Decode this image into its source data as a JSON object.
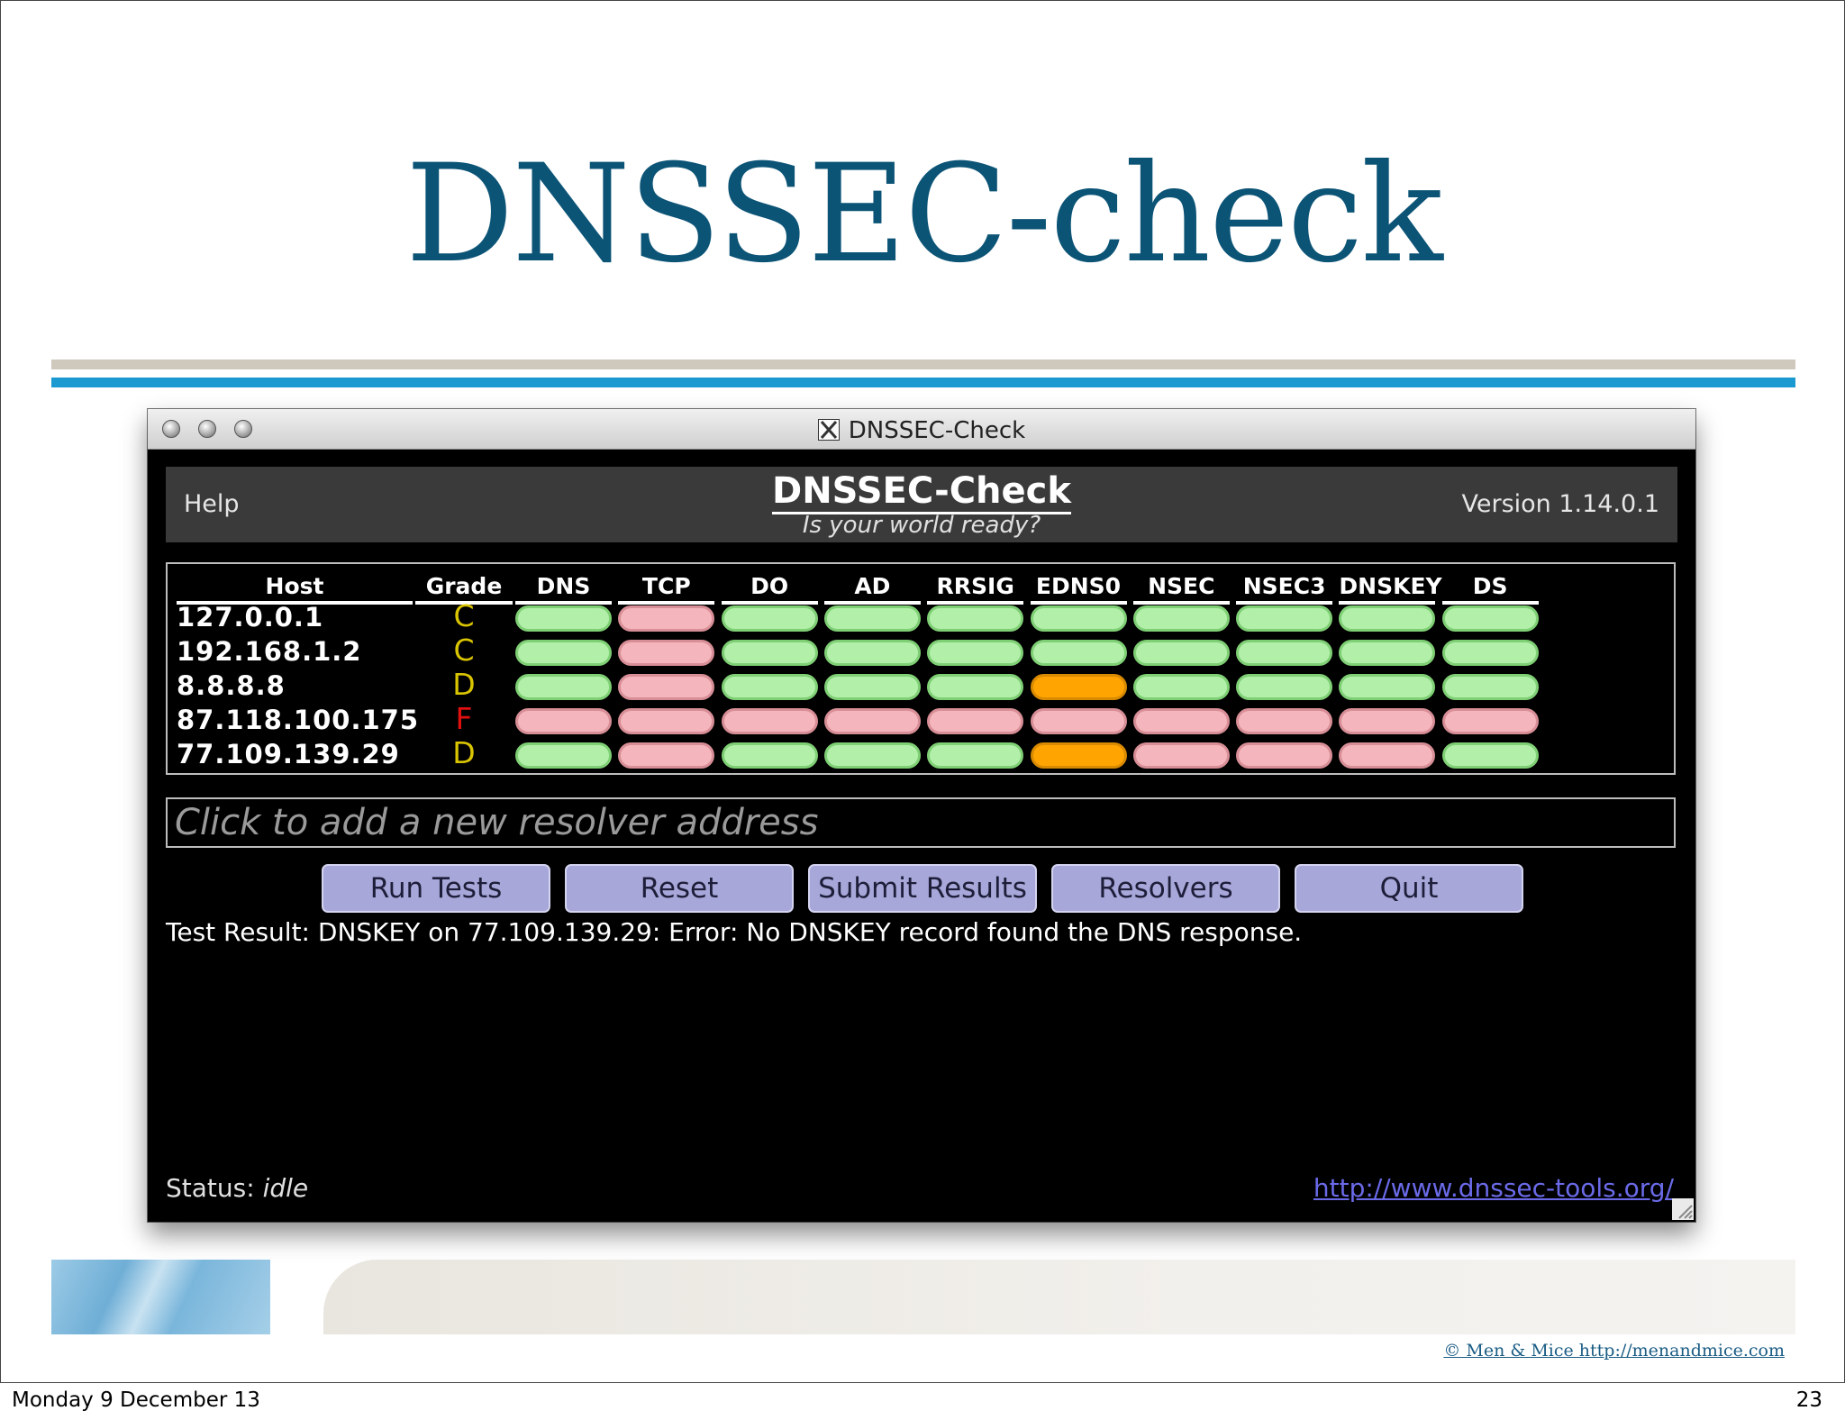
{
  "slide": {
    "title": "DNSSEC-check",
    "copyright": "© Men & Mice  http://menandmice.com"
  },
  "window": {
    "title": "DNSSEC-Check",
    "x_icon_label": "X"
  },
  "app": {
    "help_label": "Help",
    "title": "DNSSEC-Check",
    "subtitle": "Is your world ready?",
    "version": "Version 1.14.0.1"
  },
  "table": {
    "columns": [
      "Host",
      "Grade",
      "DNS",
      "TCP",
      "DO",
      "AD",
      "RRSIG",
      "EDNS0",
      "NSEC",
      "NSEC3",
      "DNSKEY",
      "DS"
    ],
    "rows": [
      {
        "host": "127.0.0.1",
        "grade": "C",
        "grade_color": "#d9c400",
        "status": [
          "pass",
          "fail",
          "pass",
          "pass",
          "pass",
          "pass",
          "pass",
          "pass",
          "pass",
          "pass"
        ]
      },
      {
        "host": "192.168.1.2",
        "grade": "C",
        "grade_color": "#d9c400",
        "status": [
          "pass",
          "fail",
          "pass",
          "pass",
          "pass",
          "pass",
          "pass",
          "pass",
          "pass",
          "pass"
        ]
      },
      {
        "host": "8.8.8.8",
        "grade": "D",
        "grade_color": "#d9c400",
        "status": [
          "pass",
          "fail",
          "pass",
          "pass",
          "pass",
          "warn",
          "pass",
          "pass",
          "pass",
          "pass"
        ]
      },
      {
        "host": "87.118.100.175",
        "grade": "F",
        "grade_color": "#e01010",
        "status": [
          "fail",
          "fail",
          "fail",
          "fail",
          "fail",
          "fail",
          "fail",
          "fail",
          "fail",
          "fail"
        ]
      },
      {
        "host": "77.109.139.29",
        "grade": "D",
        "grade_color": "#d9c400",
        "status": [
          "pass",
          "fail",
          "pass",
          "pass",
          "pass",
          "warn",
          "fail",
          "fail",
          "fail",
          "pass"
        ]
      }
    ],
    "status_colors": {
      "pass": {
        "fill": "#b2f0aa",
        "border": "#7fcf75"
      },
      "fail": {
        "fill": "#f4b6bc",
        "border": "#d88e96"
      },
      "warn": {
        "fill": "#ffa400",
        "border": "#d88a00"
      }
    }
  },
  "resolver_input": {
    "placeholder": "Click to add a new resolver address",
    "value": ""
  },
  "buttons": {
    "run_tests": "Run Tests",
    "reset": "Reset",
    "submit_results": "Submit Results",
    "resolvers": "Resolvers",
    "quit": "Quit"
  },
  "result_text": "Test Result: DNSKEY on 77.109.139.29: Error: No DNSKEY record found the DNS response.",
  "status": {
    "label": "Status:",
    "value": "idle",
    "link": "http://www.dnssec-tools.org/"
  },
  "footer": {
    "date": "Monday 9 December 13",
    "page_number": "23"
  }
}
